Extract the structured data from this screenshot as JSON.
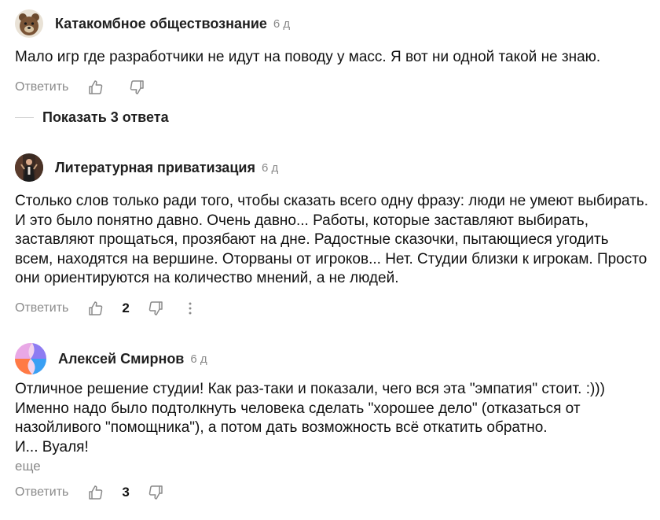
{
  "comments": [
    {
      "author": "Катакомбное обществознание",
      "time": "6 д",
      "text": "Мало игр где разработчики не идут на поводу у масс. Я вот ни одной такой не знаю.",
      "reply_label": "Ответить",
      "avatar_icon": "bear-avatar-icon"
    },
    {
      "author": "Литературная приватизация",
      "time": "6 д",
      "text": "Столько слов только ради того, чтобы сказать всего одну фразу: люди не умеют выбирать. И это было понятно давно. Очень давно... Работы, которые заставляют выбирать, заставляют прощаться, прозябают на дне. Радостные сказочки, пытающиеся угодить всем, находятся на вершине. Оторваны от игроков... Нет. Студии близки к игрокам. Просто они ориентируются на количество мнений, а не людей.",
      "reply_label": "Ответить",
      "likes": "2",
      "avatar_icon": "person-photo-avatar-icon"
    },
    {
      "author": "Алексей Смирнов",
      "time": "6 д",
      "text_lines": [
        "Отличное решение студии! Как раз-таки и показали, чего вся эта \"эмпатия\" стоит. :)))",
        "Именно надо было подтолкнуть человека сделать \"хорошее дело\" (отказаться от назойливого \"помощника\"), а потом дать возможность всё откатить обратно.",
        "И... Вуаля!"
      ],
      "more_label": "еще",
      "reply_label": "Ответить",
      "likes": "3",
      "avatar_icon": "abstract-shapes-avatar-icon"
    }
  ],
  "show_replies": {
    "label": "Показать 3 ответа"
  },
  "colors": {
    "muted": "#8a8a8a",
    "text": "#111111"
  }
}
